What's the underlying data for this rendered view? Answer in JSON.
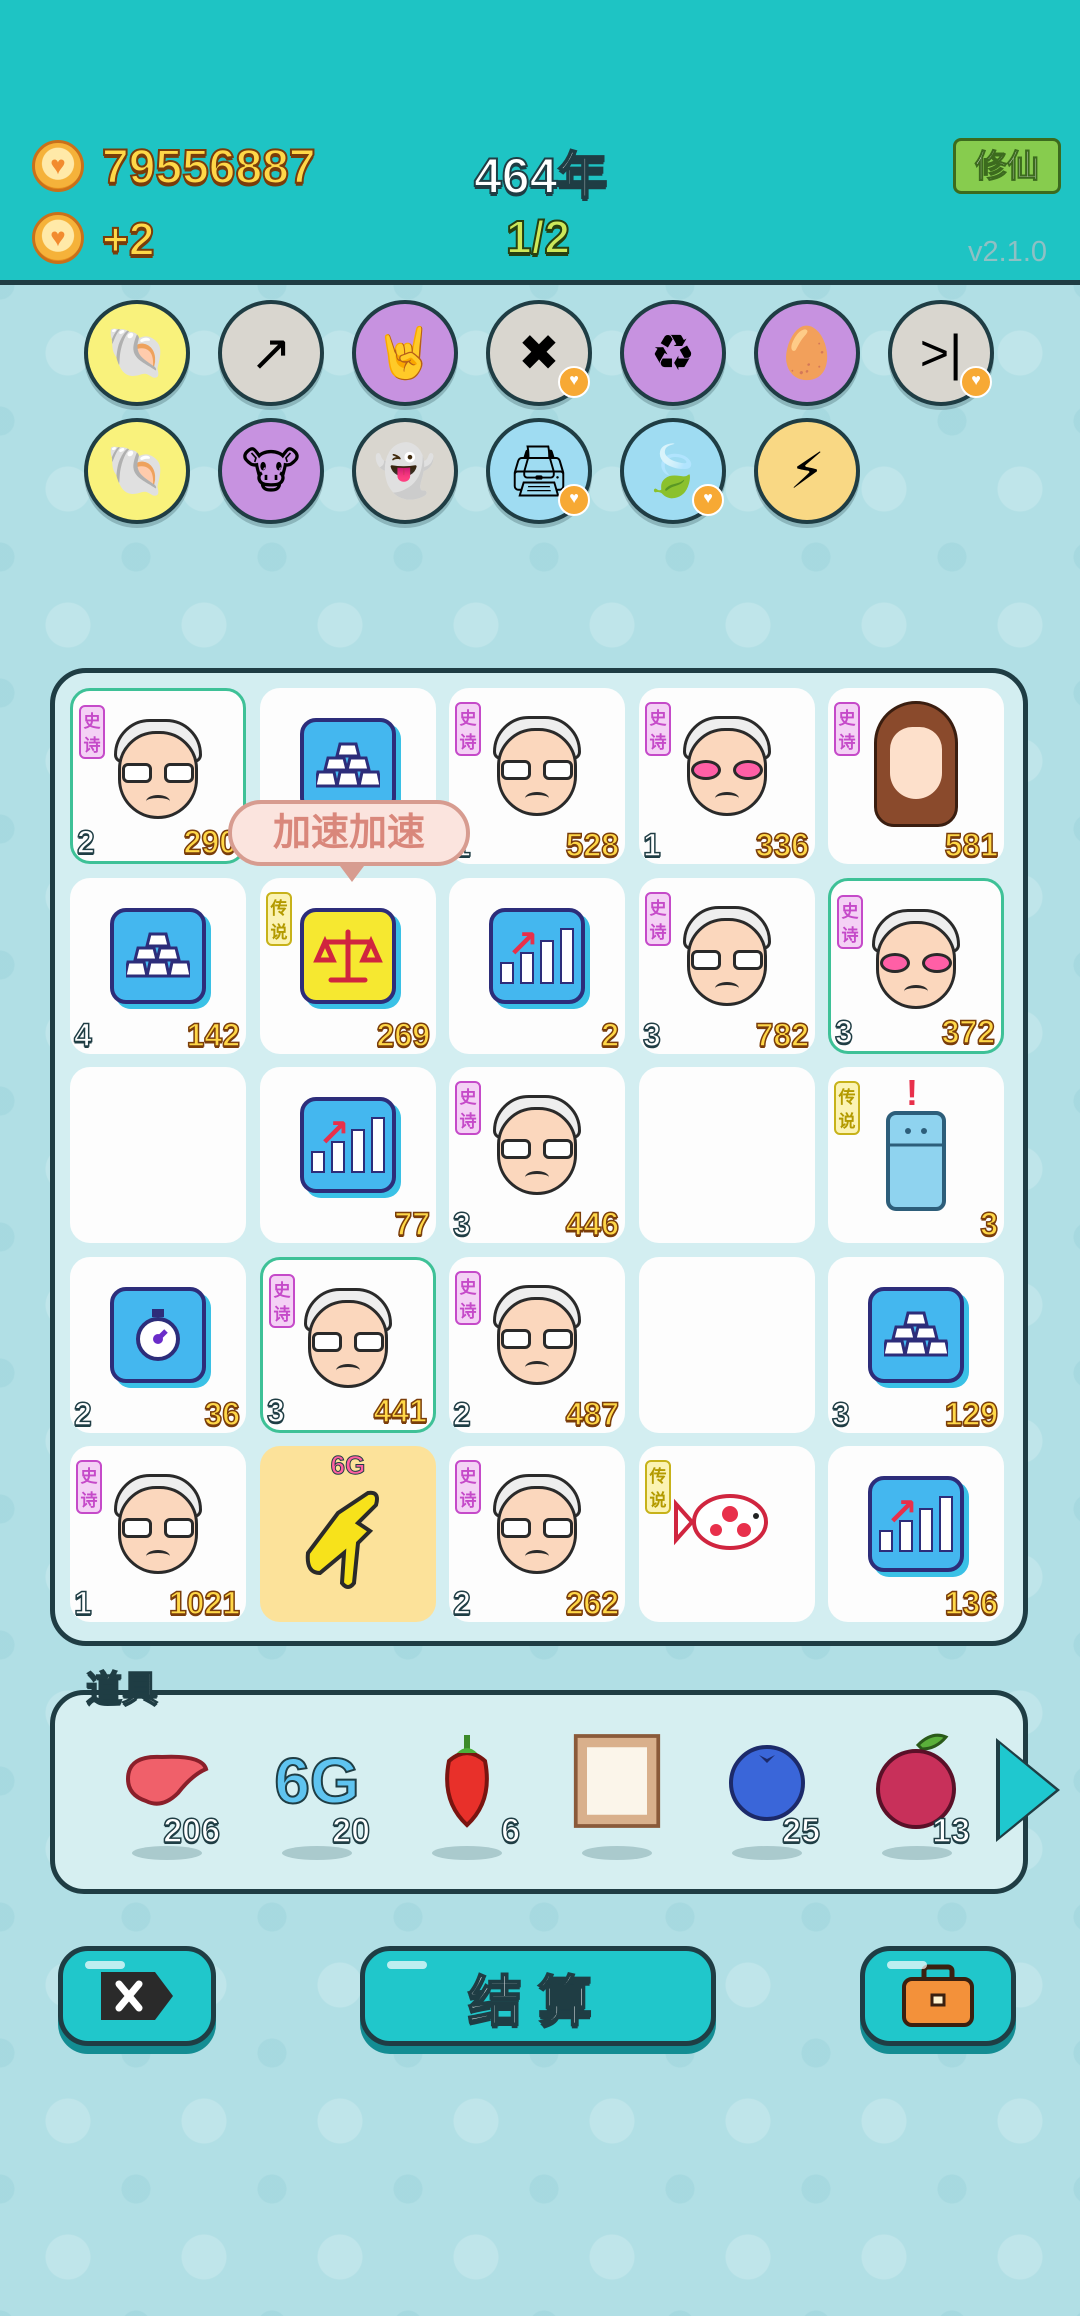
{
  "header": {
    "coins": "79556887",
    "income": "+2",
    "year": "464年",
    "progress": "1/2",
    "xiuxian_label": "修仙",
    "version": "v2.1.0"
  },
  "skills": [
    {
      "icon": "shell-icon",
      "glyph": "🐚",
      "color": "yellow"
    },
    {
      "icon": "arrow-card-icon",
      "glyph": "↗",
      "color": "grey"
    },
    {
      "icon": "rock-hand-icon",
      "glyph": "🤘",
      "color": "purple"
    },
    {
      "icon": "delete-icon",
      "glyph": "✖",
      "color": "grey",
      "badge": true
    },
    {
      "icon": "recycle-icon",
      "glyph": "♻",
      "color": "purple"
    },
    {
      "icon": "egg-icon",
      "glyph": "🥚",
      "color": "purple"
    },
    {
      "icon": "skip-icon",
      "glyph": ">|",
      "color": "grey",
      "badge": true
    },
    {
      "icon": "shell-icon",
      "glyph": "🐚",
      "color": "yellow"
    },
    {
      "icon": "cow-card-icon",
      "glyph": "🐮",
      "color": "purple"
    },
    {
      "icon": "ghost-icon",
      "glyph": "👻",
      "color": "grey"
    },
    {
      "icon": "printer-icon",
      "glyph": "🖨",
      "color": "blue",
      "badge": true
    },
    {
      "icon": "leaf-icon",
      "glyph": "🍃",
      "color": "blue",
      "badge": true
    },
    {
      "icon": "lightning-icon",
      "glyph": "⚡",
      "color": "orange"
    }
  ],
  "tooltip": "加速加速",
  "tags": {
    "epic": "史诗",
    "legend": "传说"
  },
  "board": [
    {
      "type": "oldman",
      "tag": "epic",
      "level": "2",
      "count": "290",
      "selected": true
    },
    {
      "type": "gold",
      "tag": "",
      "level": "",
      "count": ""
    },
    {
      "type": "oldman",
      "tag": "epic",
      "level": "1",
      "count": "528"
    },
    {
      "type": "oldman-pink",
      "tag": "epic",
      "level": "1",
      "count": "336"
    },
    {
      "type": "girl",
      "tag": "epic",
      "level": "",
      "count": "581"
    },
    {
      "type": "gold",
      "tag": "",
      "level": "4",
      "count": "142"
    },
    {
      "type": "scale",
      "tag": "legend",
      "level": "",
      "count": "269"
    },
    {
      "type": "chart",
      "tag": "",
      "level": "",
      "count": "2"
    },
    {
      "type": "oldman",
      "tag": "epic",
      "level": "3",
      "count": "782"
    },
    {
      "type": "oldman-pink",
      "tag": "epic",
      "level": "3",
      "count": "372",
      "selected": true
    },
    {
      "type": "empty",
      "tag": "",
      "level": "",
      "count": ""
    },
    {
      "type": "chart",
      "tag": "",
      "level": "",
      "count": "77"
    },
    {
      "type": "oldman",
      "tag": "epic",
      "level": "3",
      "count": "446"
    },
    {
      "type": "empty",
      "tag": "",
      "level": "",
      "count": ""
    },
    {
      "type": "fridge",
      "tag": "legend",
      "level": "",
      "count": "3"
    },
    {
      "type": "timer",
      "tag": "",
      "level": "2",
      "count": "36"
    },
    {
      "type": "oldman",
      "tag": "epic",
      "level": "3",
      "count": "441",
      "selected": true
    },
    {
      "type": "oldman",
      "tag": "epic",
      "level": "2",
      "count": "487"
    },
    {
      "type": "empty",
      "tag": "",
      "level": "",
      "count": ""
    },
    {
      "type": "gold",
      "tag": "",
      "level": "3",
      "count": "129"
    },
    {
      "type": "oldman",
      "tag": "epic",
      "level": "1",
      "count": "1021"
    },
    {
      "type": "hand",
      "tag": "",
      "level": "",
      "count": "",
      "label": "6G"
    },
    {
      "type": "oldman",
      "tag": "epic",
      "level": "2",
      "count": "262"
    },
    {
      "type": "fish",
      "tag": "legend",
      "level": "",
      "count": ""
    },
    {
      "type": "chart",
      "tag": "",
      "level": "",
      "count": "136"
    }
  ],
  "items_label": "道具",
  "items": [
    {
      "icon": "liver-icon",
      "count": "206"
    },
    {
      "icon": "6g-icon",
      "text": "6G",
      "count": "20"
    },
    {
      "icon": "chili-icon",
      "count": "6"
    },
    {
      "icon": "frame-icon",
      "count": ""
    },
    {
      "icon": "blueberry-icon",
      "count": "25"
    },
    {
      "icon": "lychee-icon",
      "count": "13"
    }
  ],
  "buttons": {
    "settle_label": "结算"
  }
}
